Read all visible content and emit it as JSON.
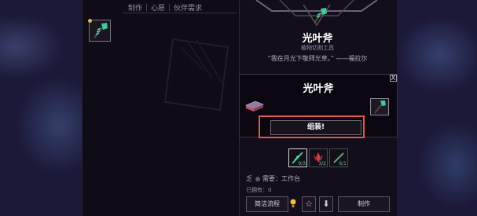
{
  "tabs": [
    "制作",
    "心愿",
    "伙伴需求"
  ],
  "item": {
    "name": "光叶斧",
    "subtitle": "植物切割工具",
    "quote": "“我在月光下敬拜光草。” ——福拉尔"
  },
  "popup": {
    "title": "光叶斧",
    "close_label": "X",
    "assemble_label": "组装!"
  },
  "ingredients": [
    {
      "icon": "leaf-blade-icon",
      "count": "9/3",
      "color": "#3fc9a0"
    },
    {
      "icon": "red-crystal-icon",
      "count": "3/2",
      "color": "#d04046"
    },
    {
      "icon": "stick-icon",
      "count": "6/1",
      "color": "#5f9e83"
    }
  ],
  "requirement": {
    "prefix": "乏",
    "text": "需要：工作台"
  },
  "owned": "已拥有：0",
  "buttons": {
    "quick": "简洁流程",
    "star": "☆",
    "download": "⬇",
    "craft": "制作"
  },
  "colors": {
    "highlight": "#e8554d",
    "accent_green": "#3fc9a0",
    "panel": "#120e1b"
  }
}
